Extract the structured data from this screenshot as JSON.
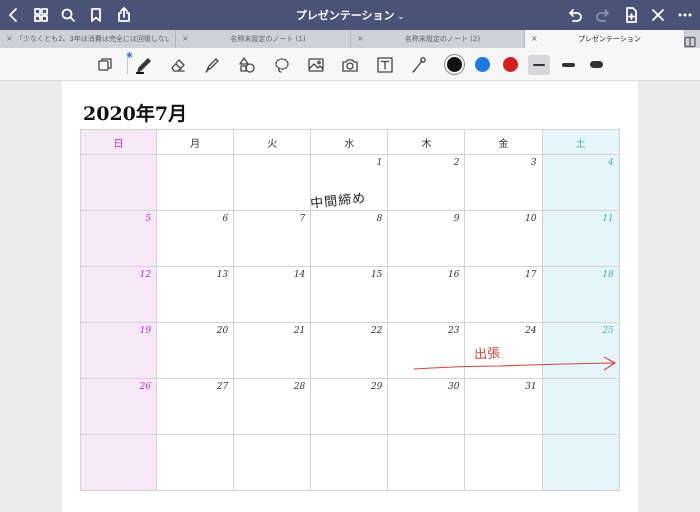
{
  "topbar": {
    "title": "プレゼンテーション",
    "icons": [
      "back-icon",
      "grid-icon",
      "search-icon",
      "bookmark-icon",
      "share-icon",
      "undo-icon",
      "redo-icon",
      "add-page-icon",
      "close-icon",
      "more-icon"
    ]
  },
  "tabs": [
    {
      "label": "「少なくとも2、3年は消費は完全には回復しない」"
    },
    {
      "label": "名称未設定のノート (1)"
    },
    {
      "label": "名称未設定のノート (2)"
    },
    {
      "label": "プレゼンテーション",
      "active": true
    }
  ],
  "toolbar": {
    "tools": [
      "reader-icon",
      "pen-icon",
      "eraser-icon",
      "highlighter-icon",
      "shapes-icon",
      "lasso-icon",
      "image-icon",
      "camera-icon",
      "text-icon",
      "laser-icon"
    ],
    "bluetooth": "✱",
    "colors": [
      "#111111",
      "#1f7ae0",
      "#d62020"
    ],
    "selected_color": "#111111"
  },
  "calendar": {
    "title": "2020年7月",
    "weekdays": [
      "日",
      "月",
      "火",
      "水",
      "木",
      "金",
      "土"
    ],
    "weeks": [
      [
        "",
        "",
        "",
        "1",
        "2",
        "3",
        "4"
      ],
      [
        "5",
        "6",
        "7",
        "8",
        "9",
        "10",
        "11"
      ],
      [
        "12",
        "13",
        "14",
        "15",
        "16",
        "17",
        "18"
      ],
      [
        "19",
        "20",
        "21",
        "22",
        "23",
        "24",
        "25"
      ],
      [
        "26",
        "27",
        "28",
        "29",
        "30",
        "31",
        ""
      ],
      [
        "",
        "",
        "",
        "",
        "",
        "",
        ""
      ]
    ],
    "colors": {
      "sunday": "#b030c0",
      "saturday": "#3fb0c0"
    }
  },
  "annotations": {
    "handwriting_black": "中間締め",
    "handwriting_red": "出張"
  }
}
